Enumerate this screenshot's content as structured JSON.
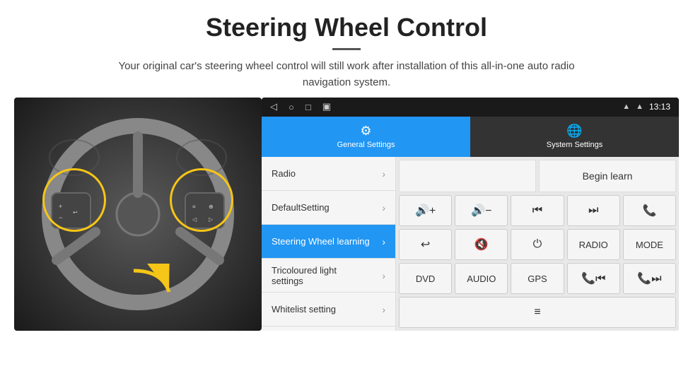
{
  "header": {
    "title": "Steering Wheel Control",
    "subtitle": "Your original car's steering wheel control will still work after installation of this all-in-one auto radio navigation system."
  },
  "android_ui": {
    "status_bar": {
      "time": "13:13"
    },
    "tabs": [
      {
        "label": "General Settings",
        "icon": "⚙",
        "active": true
      },
      {
        "label": "System Settings",
        "icon": "🌐",
        "active": false
      }
    ],
    "menu_items": [
      {
        "label": "Radio",
        "active": false
      },
      {
        "label": "DefaultSetting",
        "active": false
      },
      {
        "label": "Steering Wheel learning",
        "active": true
      },
      {
        "label": "Tricoloured light settings",
        "active": false
      },
      {
        "label": "Whitelist setting",
        "active": false
      }
    ],
    "control_grid": {
      "begin_learn": "Begin learn",
      "row1": [
        "🔊+",
        "🔊−",
        "⏮",
        "⏭",
        "📞"
      ],
      "row2": [
        "↩",
        "🔊×",
        "⏻",
        "RADIO",
        "MODE"
      ],
      "row3": [
        "DVD",
        "AUDIO",
        "GPS",
        "📞⏮",
        "📞⏭"
      ],
      "row4": [
        "≡"
      ]
    }
  }
}
